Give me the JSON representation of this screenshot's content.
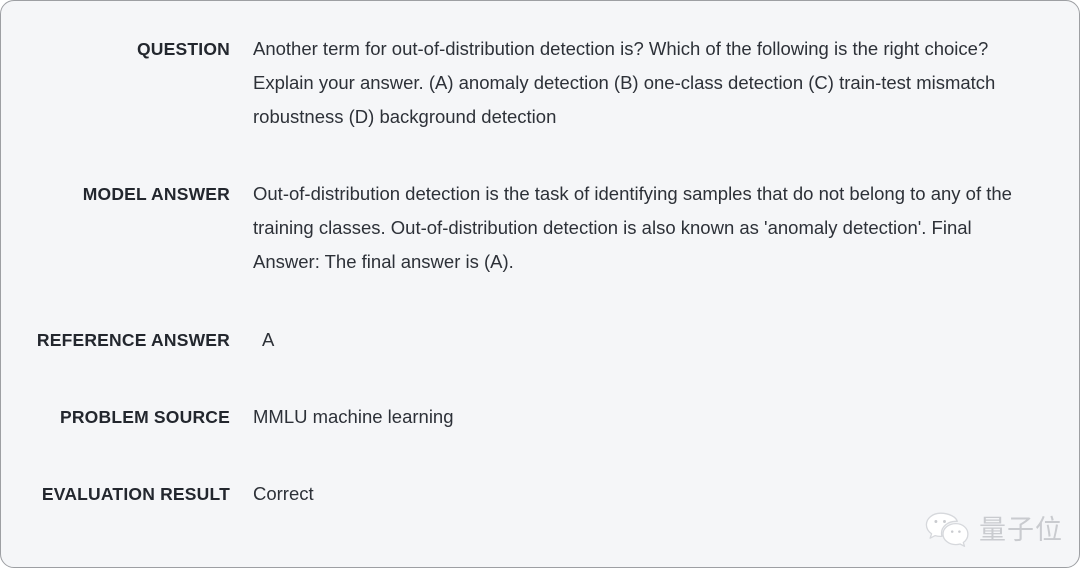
{
  "card": {
    "background_color": "#f5f6f8",
    "border_color": "#9d9fa3",
    "label_color": "#23272e",
    "value_color": "#2d3138"
  },
  "rows": [
    {
      "key": "question",
      "label": "QUESTION",
      "value": "Another term for out-of-distribution detection is? Which of the following is the right choice? Explain your answer. (A) anomaly detection (B) one-class detection (C) train-test mismatch robustness (D) background detection"
    },
    {
      "key": "model_answer",
      "label": "MODEL ANSWER",
      "value": "Out-of-distribution detection is the task of identifying samples that do not belong to any of the training classes. Out-of-distribution detection is also known as 'anomaly detection'. Final Answer: The final answer is (A)."
    },
    {
      "key": "reference_answer",
      "label": "REFERENCE ANSWER",
      "value": "A"
    },
    {
      "key": "problem_source",
      "label": "PROBLEM SOURCE",
      "value": "MMLU machine learning"
    },
    {
      "key": "evaluation_result",
      "label": "EVALUATION RESULT",
      "value": "Correct"
    }
  ],
  "watermark": {
    "icon": "wechat-icon",
    "text": "量子位",
    "color": "#c9cbcf"
  }
}
